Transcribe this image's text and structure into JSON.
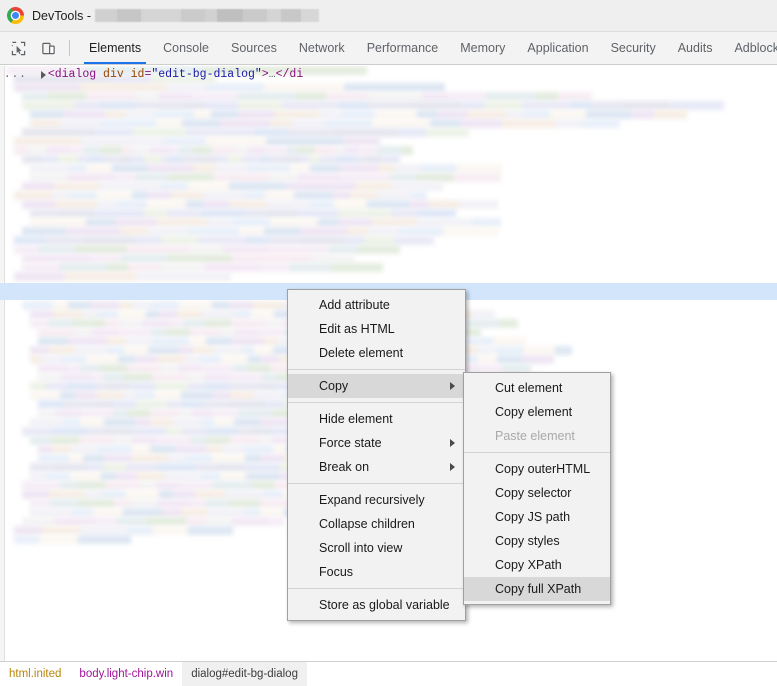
{
  "window": {
    "title_prefix": "DevTools -",
    "title_redacted": true,
    "logo_icon": "chrome-logo-icon"
  },
  "toolbar": {
    "inspect_icon": "inspect-element-icon",
    "device_icon": "device-toolbar-icon"
  },
  "tabs": [
    {
      "label": "Elements",
      "active": true
    },
    {
      "label": "Console",
      "active": false
    },
    {
      "label": "Sources",
      "active": false
    },
    {
      "label": "Network",
      "active": false
    },
    {
      "label": "Performance",
      "active": false
    },
    {
      "label": "Memory",
      "active": false
    },
    {
      "label": "Application",
      "active": false
    },
    {
      "label": "Security",
      "active": false
    },
    {
      "label": "Audits",
      "active": false
    },
    {
      "label": "Adblock Pl",
      "active": false
    }
  ],
  "dom": {
    "selected_row": {
      "ellipsis": "...",
      "open_punct": "<",
      "tag": "dialog",
      "attr_name": "div id",
      "equals": "=",
      "attr_value": "\"edit-bg-dialog\"",
      "close_punct": ">",
      "collapsed": "…",
      "closing": "</di"
    },
    "content_redacted": true
  },
  "context_menu": {
    "groups": [
      {
        "items": [
          {
            "label": "Add attribute",
            "highlighted": false,
            "submenu": false,
            "disabled": false
          },
          {
            "label": "Edit as HTML",
            "highlighted": false,
            "submenu": false,
            "disabled": false
          },
          {
            "label": "Delete element",
            "highlighted": false,
            "submenu": false,
            "disabled": false
          }
        ]
      },
      {
        "items": [
          {
            "label": "Copy",
            "highlighted": true,
            "submenu": true,
            "disabled": false
          }
        ]
      },
      {
        "items": [
          {
            "label": "Hide element",
            "highlighted": false,
            "submenu": false,
            "disabled": false
          },
          {
            "label": "Force state",
            "highlighted": false,
            "submenu": true,
            "disabled": false
          },
          {
            "label": "Break on",
            "highlighted": false,
            "submenu": true,
            "disabled": false
          }
        ]
      },
      {
        "items": [
          {
            "label": "Expand recursively",
            "highlighted": false,
            "submenu": false,
            "disabled": false
          },
          {
            "label": "Collapse children",
            "highlighted": false,
            "submenu": false,
            "disabled": false
          },
          {
            "label": "Scroll into view",
            "highlighted": false,
            "submenu": false,
            "disabled": false
          },
          {
            "label": "Focus",
            "highlighted": false,
            "submenu": false,
            "disabled": false
          }
        ]
      },
      {
        "items": [
          {
            "label": "Store as global variable",
            "highlighted": false,
            "submenu": false,
            "disabled": false
          }
        ]
      }
    ]
  },
  "context_submenu": {
    "groups": [
      {
        "items": [
          {
            "label": "Cut element",
            "highlighted": false,
            "disabled": false
          },
          {
            "label": "Copy element",
            "highlighted": false,
            "disabled": false
          },
          {
            "label": "Paste element",
            "highlighted": false,
            "disabled": true
          }
        ]
      },
      {
        "items": [
          {
            "label": "Copy outerHTML",
            "highlighted": false,
            "disabled": false
          },
          {
            "label": "Copy selector",
            "highlighted": false,
            "disabled": false
          },
          {
            "label": "Copy JS path",
            "highlighted": false,
            "disabled": false
          },
          {
            "label": "Copy styles",
            "highlighted": false,
            "disabled": false
          },
          {
            "label": "Copy XPath",
            "highlighted": false,
            "disabled": false
          },
          {
            "label": "Copy full XPath",
            "highlighted": true,
            "disabled": false
          }
        ]
      }
    ]
  },
  "breadcrumb": [
    {
      "label": "html.inited",
      "selected": false,
      "color": "#b8860b"
    },
    {
      "label": "body.light-chip.win",
      "selected": false,
      "color": "#a0149a"
    },
    {
      "label": "dialog#edit-bg-dialog",
      "selected": true,
      "color": "#3c3c3c"
    }
  ],
  "colors": {
    "accent": "#1a73e8",
    "selection_row": "#d2e5fa",
    "menu_highlight": "#d8d8d8",
    "menu_bg": "#f2f2f2",
    "titlebar_bg": "#efefef",
    "tabstrip_bg": "#f3f3f3"
  }
}
